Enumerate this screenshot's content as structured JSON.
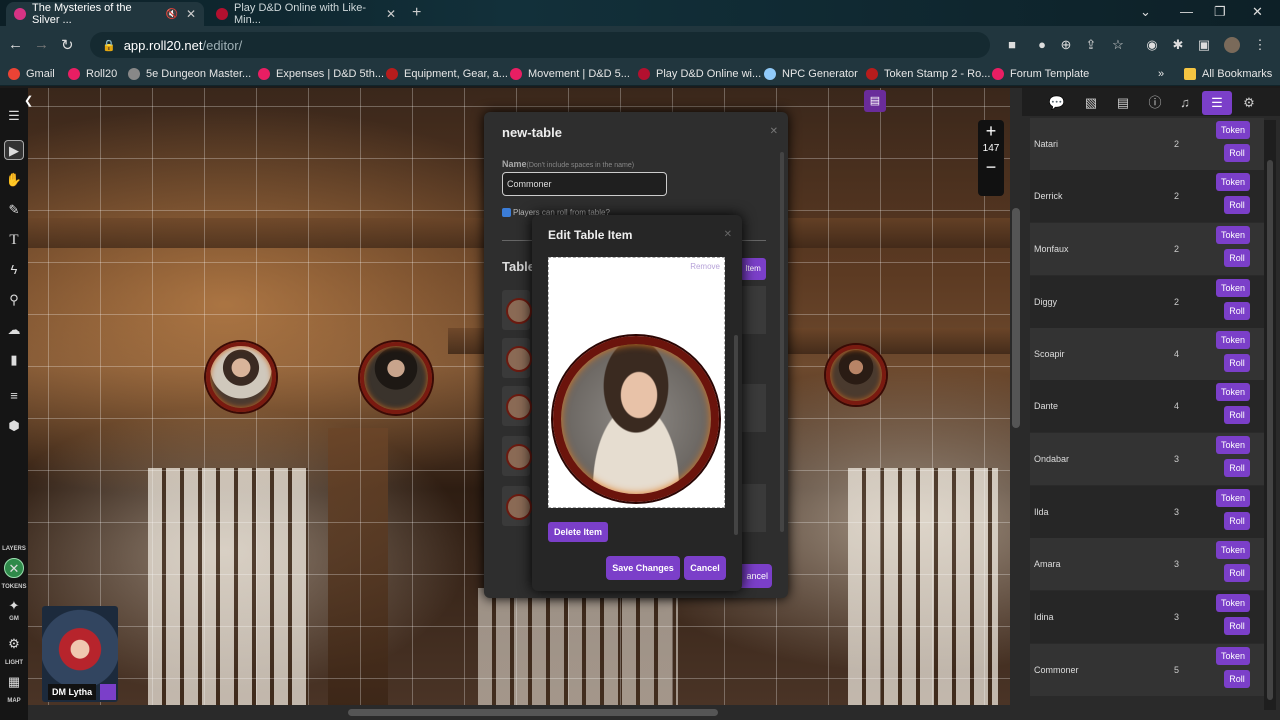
{
  "browser": {
    "tabs": [
      {
        "title": "The Mysteries of the Silver ...",
        "active": true,
        "muted_icon": "speaker-mute-icon",
        "favicon_color": "#d63384"
      },
      {
        "title": "Play D&D Online with Like-Min...",
        "active": false,
        "favicon_color": "#b2102f"
      }
    ],
    "url_host": "app.roll20.net",
    "url_path": "/editor/",
    "bookmarks": [
      {
        "label": "Gmail",
        "color": "#ea4335"
      },
      {
        "label": "Roll20",
        "color": "#e91e63"
      },
      {
        "label": "5e Dungeon Master...",
        "color": "#888888"
      },
      {
        "label": "Expenses | D&D 5th...",
        "color": "#e91e63"
      },
      {
        "label": "Equipment, Gear, a...",
        "color": "#b71c1c"
      },
      {
        "label": "Movement | D&D 5...",
        "color": "#e91e63"
      },
      {
        "label": "Play D&D Online wi...",
        "color": "#b2102f"
      },
      {
        "label": "NPC Generator",
        "color": "#90caf9"
      },
      {
        "label": "Token Stamp 2 - Ro...",
        "color": "#b71c1c"
      },
      {
        "label": "Forum Template",
        "color": "#e91e63"
      }
    ],
    "all_bookmarks": "All Bookmarks"
  },
  "canvas": {
    "zoom_level": "147",
    "zoom_in": "+",
    "zoom_out": "−",
    "layer_labels": {
      "layers": "LAYERS",
      "tokens": "TOKENS",
      "gm": "GM",
      "light": "LIGHT",
      "map": "MAP"
    },
    "player": {
      "name": "DM Lytha",
      "color": "#7b3fc9"
    }
  },
  "table_dialog": {
    "title": "new-table",
    "name_label": "Name",
    "name_hint": "(Don't include spaces in the name)",
    "name_value": "Commoner",
    "players_can_roll": "Players can roll from table?",
    "section_title": "Table",
    "add_item": "Item",
    "cancel": "ancel"
  },
  "item_dialog": {
    "title": "Edit Table Item",
    "remove": "Remove",
    "delete_item": "Delete Item",
    "save_changes": "Save Changes",
    "cancel": "Cancel"
  },
  "sidebar": {
    "active_tab": "rollable-tables",
    "rows": [
      {
        "name": "Natari",
        "weight": "2"
      },
      {
        "name": "Derrick",
        "weight": "2"
      },
      {
        "name": "Monfaux",
        "weight": "2"
      },
      {
        "name": "Diggy",
        "weight": "2"
      },
      {
        "name": "Scoapir",
        "weight": "4"
      },
      {
        "name": "Dante",
        "weight": "4"
      },
      {
        "name": "Ondabar",
        "weight": "3"
      },
      {
        "name": "Ilda",
        "weight": "3"
      },
      {
        "name": "Amara",
        "weight": "3"
      },
      {
        "name": "Idina",
        "weight": "3"
      },
      {
        "name": "Commoner",
        "weight": "5"
      }
    ],
    "token_label": "Token",
    "roll_label": "Roll"
  }
}
